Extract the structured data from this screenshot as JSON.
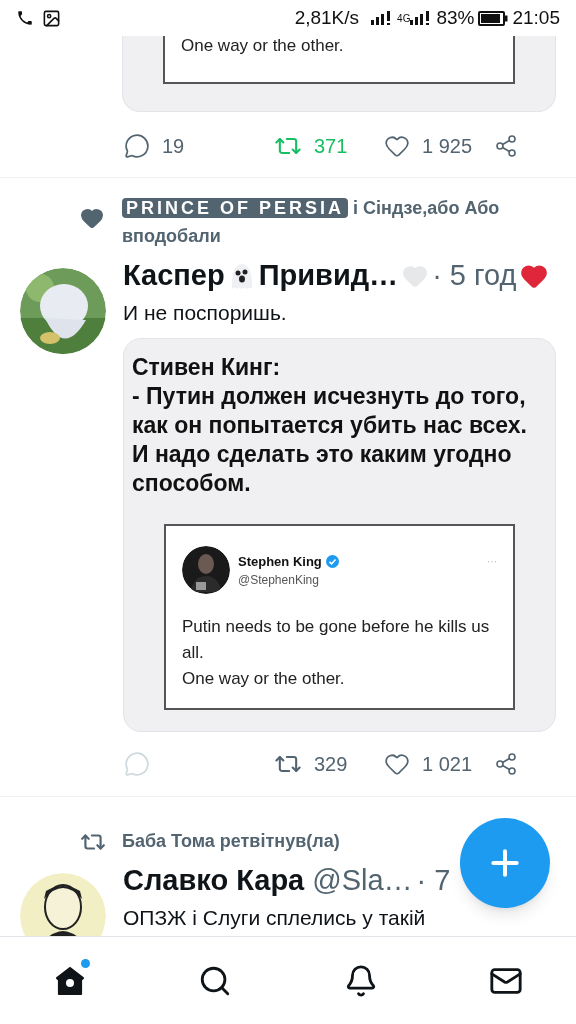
{
  "status_bar": {
    "net_speed": "2,81K/s",
    "network": "4G",
    "battery": "83%",
    "time": "21:05"
  },
  "top_tweet": {
    "quote_lines": [
      "One way or the other."
    ],
    "actions": {
      "replies": "19",
      "reply_faded": false,
      "retweets": "371",
      "retweeted": true,
      "likes": "1 925",
      "liked": false
    }
  },
  "tweets": [
    {
      "context": {
        "kind": "liked",
        "name": "PRINCE OF PERSIA",
        "text": "і Сіндзе,або Або вподобали"
      },
      "name_before_icon": "Каспер",
      "name_after_icon": "Привид…",
      "name_icon": {
        "kind": "ghost"
      },
      "time": "· 5 год",
      "text": "И не поспоришь.",
      "media": {
        "caption": "Стивен Кинг:\n- Путин должен исчезнуть до того, как он попытается убить нас всех. И надо сделать это каким угодно способом.",
        "embedded": {
          "name": "Stephen King",
          "verified": true,
          "handle": "@StephenKing",
          "menu": "···",
          "text": "Putin needs to be gone before he kills us all.\nOne way or the other."
        }
      },
      "actions": {
        "reply_faded": true,
        "retweets": "329",
        "retweeted": false,
        "likes": "1 021",
        "liked": false
      }
    },
    {
      "context": {
        "kind": "retweet",
        "text": "Баба Тома ретвітнув(ла)"
      },
      "name_before_icon": "Славко Кара",
      "handle": "@Sla…",
      "time": "· 7",
      "text": "ОПЗЖ і Слуги сплелись у такій"
    }
  ],
  "fab": {
    "kind": "compose"
  },
  "nav": [
    {
      "kind": "home",
      "selected": true,
      "badge": true
    },
    {
      "kind": "search",
      "selected": false,
      "badge": false
    },
    {
      "kind": "notifications",
      "selected": false,
      "badge": false
    },
    {
      "kind": "messages",
      "selected": false,
      "badge": false
    }
  ]
}
